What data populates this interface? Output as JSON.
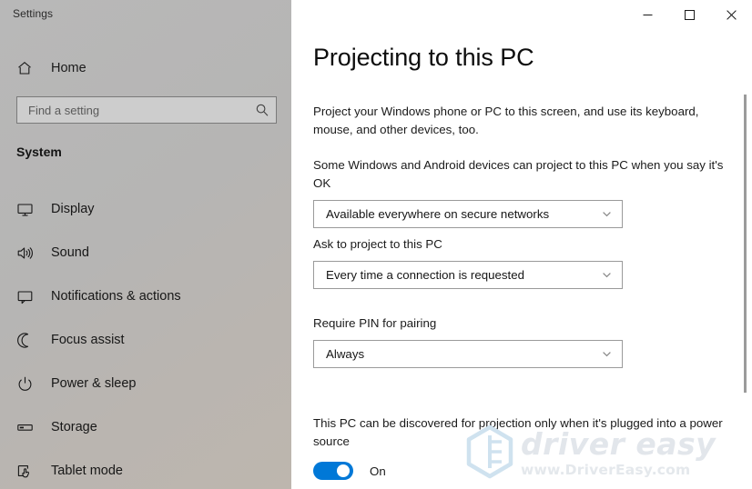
{
  "window": {
    "title": "Settings",
    "controls": [
      {
        "name": "minimize",
        "glyph": "minimize-icon"
      },
      {
        "name": "maximize",
        "glyph": "maximize-icon"
      },
      {
        "name": "close",
        "glyph": "close-icon"
      }
    ]
  },
  "sidebar": {
    "home_label": "Home",
    "home_icon": "home-icon",
    "search": {
      "placeholder": "Find a setting",
      "value": "",
      "icon": "search-icon"
    },
    "section_title": "System",
    "items": [
      {
        "label": "Display",
        "icon": "monitor-icon"
      },
      {
        "label": "Sound",
        "icon": "speaker-icon"
      },
      {
        "label": "Notifications & actions",
        "icon": "speech-bubble-icon"
      },
      {
        "label": "Focus assist",
        "icon": "moon-icon"
      },
      {
        "label": "Power & sleep",
        "icon": "power-icon"
      },
      {
        "label": "Storage",
        "icon": "drive-icon"
      },
      {
        "label": "Tablet mode",
        "icon": "tablet-hand-icon"
      }
    ]
  },
  "content": {
    "page_title": "Projecting to this PC",
    "intro": "Project your Windows phone or PC to this screen, and use its keyboard, mouse, and other devices, too.",
    "groups": [
      {
        "label": "Some Windows and Android devices can project to this PC when you say it's OK",
        "value": "Available everywhere on secure networks",
        "chevron": "chevron-down-icon"
      },
      {
        "label": "Ask to project to this PC",
        "value": "Every time a connection is requested",
        "chevron": "chevron-down-icon"
      },
      {
        "label": "Require PIN for pairing",
        "value": "Always",
        "chevron": "chevron-down-icon"
      }
    ],
    "power_setting": {
      "label": "This PC can be discovered for projection only when it's plugged into a power source",
      "toggle_state": "On"
    }
  },
  "watermark": {
    "brand": "driver easy",
    "url": "www.DriverEasy.com",
    "logo": "hexagon-logo-icon",
    "color": "#e2e6eb"
  },
  "colors": {
    "accent": "#0078d7",
    "sidebar_bg": "#b6b6b6",
    "content_bg": "#ffffff",
    "text": "#1b1b1b"
  }
}
